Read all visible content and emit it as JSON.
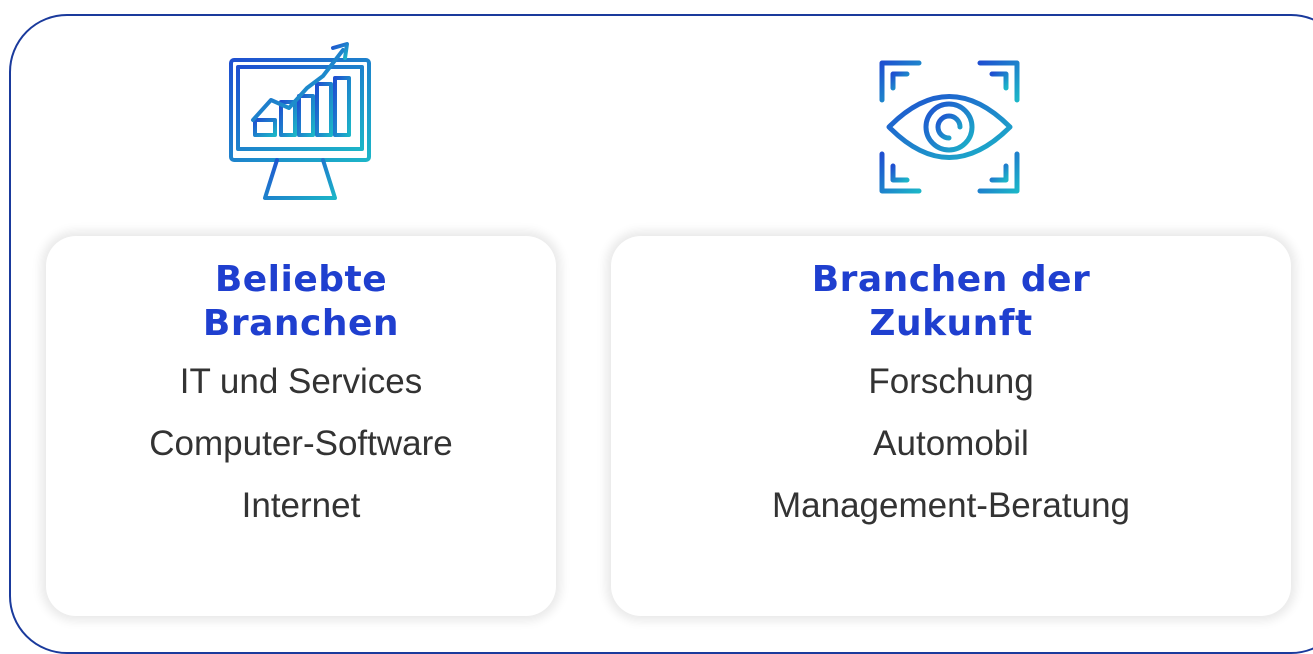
{
  "colors": {
    "border": "#1a3a9c",
    "heading": "#1f3fcf",
    "text": "#333333",
    "icon_gradient_start": "#1f4fd0",
    "icon_gradient_end": "#1cb5c8"
  },
  "cards": [
    {
      "icon": "growth-chart-monitor-icon",
      "title_line1": "Beliebte",
      "title_line2": "Branchen",
      "items": [
        "IT und Services",
        "Computer-Software",
        "Internet"
      ]
    },
    {
      "icon": "eye-scan-icon",
      "title_line1": "Branchen der",
      "title_line2": "Zukunft",
      "items": [
        "Forschung",
        "Automobil",
        "Management-Beratung"
      ]
    }
  ]
}
